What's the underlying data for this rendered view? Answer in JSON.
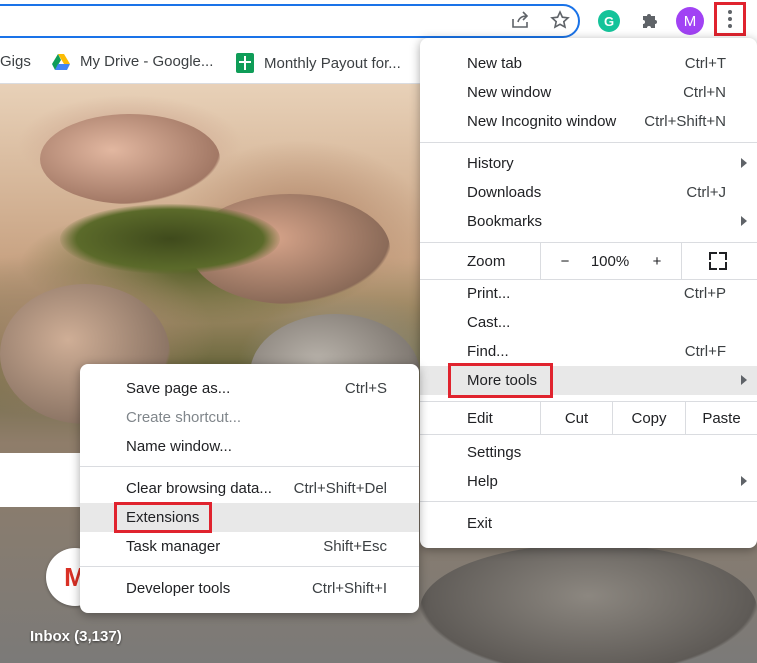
{
  "bookmarks": [
    {
      "label": "Gigs"
    },
    {
      "label": "My Drive - Google..."
    },
    {
      "label": "Monthly Payout for..."
    }
  ],
  "toolbar": {
    "grammarly_letter": "G",
    "avatar_letter": "M"
  },
  "menu": {
    "new_tab": {
      "label": "New tab",
      "shortcut": "Ctrl+T"
    },
    "new_window": {
      "label": "New window",
      "shortcut": "Ctrl+N"
    },
    "new_incognito": {
      "label": "New Incognito window",
      "shortcut": "Ctrl+Shift+N"
    },
    "history": {
      "label": "History"
    },
    "downloads": {
      "label": "Downloads",
      "shortcut": "Ctrl+J"
    },
    "bookmarks": {
      "label": "Bookmarks"
    },
    "zoom": {
      "label": "Zoom",
      "minus": "−",
      "value": "100%",
      "plus": "+"
    },
    "print": {
      "label": "Print...",
      "shortcut": "Ctrl+P"
    },
    "cast": {
      "label": "Cast..."
    },
    "find": {
      "label": "Find...",
      "shortcut": "Ctrl+F"
    },
    "more_tools": {
      "label": "More tools"
    },
    "edit": {
      "label": "Edit",
      "cut": "Cut",
      "copy": "Copy",
      "paste": "Paste"
    },
    "settings": {
      "label": "Settings"
    },
    "help": {
      "label": "Help"
    },
    "exit": {
      "label": "Exit"
    }
  },
  "submenu": {
    "save_page": {
      "label": "Save page as...",
      "shortcut": "Ctrl+S"
    },
    "create_shortcut": {
      "label": "Create shortcut..."
    },
    "name_window": {
      "label": "Name window..."
    },
    "clear_data": {
      "label": "Clear browsing data...",
      "shortcut": "Ctrl+Shift+Del"
    },
    "extensions": {
      "label": "Extensions"
    },
    "task_manager": {
      "label": "Task manager",
      "shortcut": "Shift+Esc"
    },
    "dev_tools": {
      "label": "Developer tools",
      "shortcut": "Ctrl+Shift+I"
    }
  },
  "page": {
    "gmail_letter": "M",
    "inbox_label": "Inbox (3,137)"
  },
  "colors": {
    "highlight_border": "#e0232e",
    "omnibox_border": "#1a73e8",
    "avatar": "#a142f4",
    "grammarly": "#15c39a"
  }
}
